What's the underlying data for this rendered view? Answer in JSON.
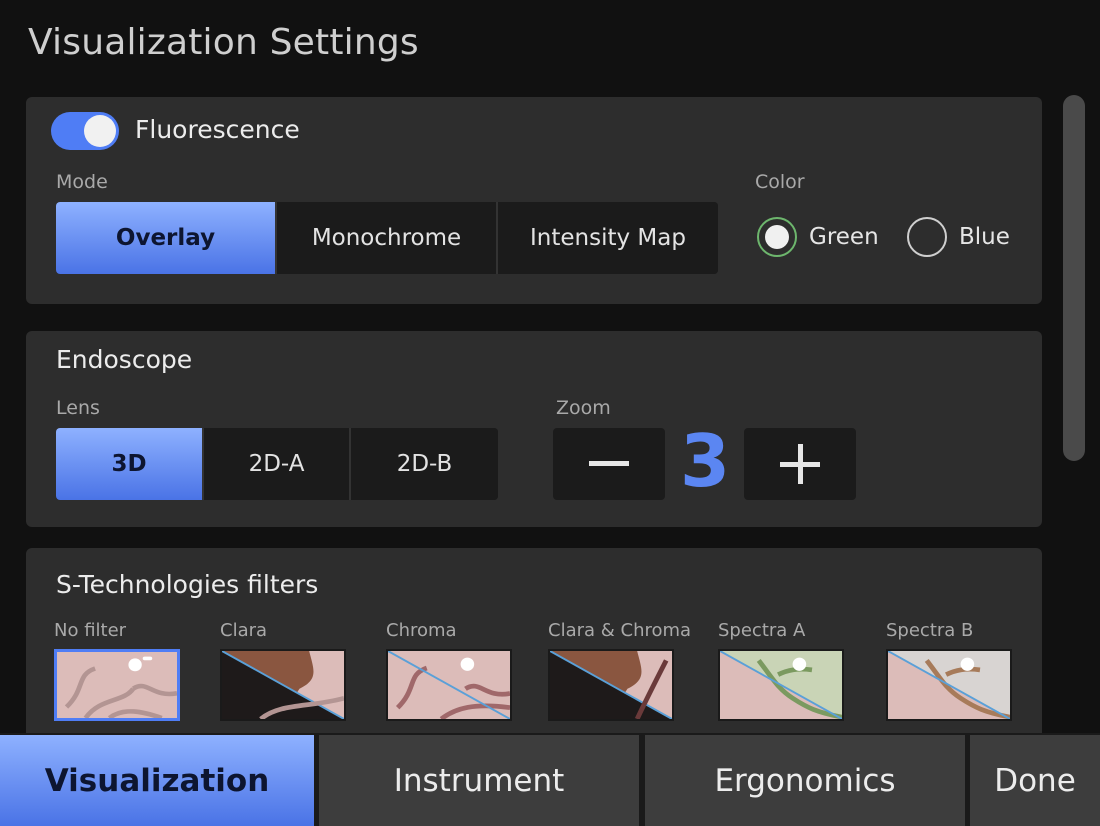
{
  "page": {
    "title": "Visualization Settings"
  },
  "fluorescence": {
    "label": "Fluorescence",
    "enabled": true,
    "mode_label": "Mode",
    "modes": [
      "Overlay",
      "Monochrome",
      "Intensity Map"
    ],
    "selected_mode": "Overlay",
    "color_label": "Color",
    "colors": [
      "Green",
      "Blue"
    ],
    "selected_color": "Green"
  },
  "endoscope": {
    "title": "Endoscope",
    "lens_label": "Lens",
    "lenses": [
      "3D",
      "2D-A",
      "2D-B"
    ],
    "selected_lens": "3D",
    "zoom_label": "Zoom",
    "zoom_value": "3",
    "minus_symbol": "−",
    "plus_symbol": "+"
  },
  "filters": {
    "title": "S-Technologies filters",
    "items": [
      {
        "label": "No filter",
        "icon": "no-filter-thumbnail"
      },
      {
        "label": "Clara",
        "icon": "clara-thumbnail"
      },
      {
        "label": "Chroma",
        "icon": "chroma-thumbnail"
      },
      {
        "label": "Clara & Chroma",
        "icon": "clara-chroma-thumbnail"
      },
      {
        "label": "Spectra A",
        "icon": "spectra-a-thumbnail"
      },
      {
        "label": "Spectra B",
        "icon": "spectra-b-thumbnail"
      }
    ],
    "selected": "No filter"
  },
  "tabs": {
    "items": [
      "Visualization",
      "Instrument",
      "Ergonomics",
      "Done"
    ],
    "active": "Visualization"
  },
  "colors": {
    "accent": "#4f7df5",
    "panel": "#2d2d2d",
    "background": "#111111",
    "zoom_value": "#5b86f2",
    "radio_selected": "#6db66d"
  }
}
